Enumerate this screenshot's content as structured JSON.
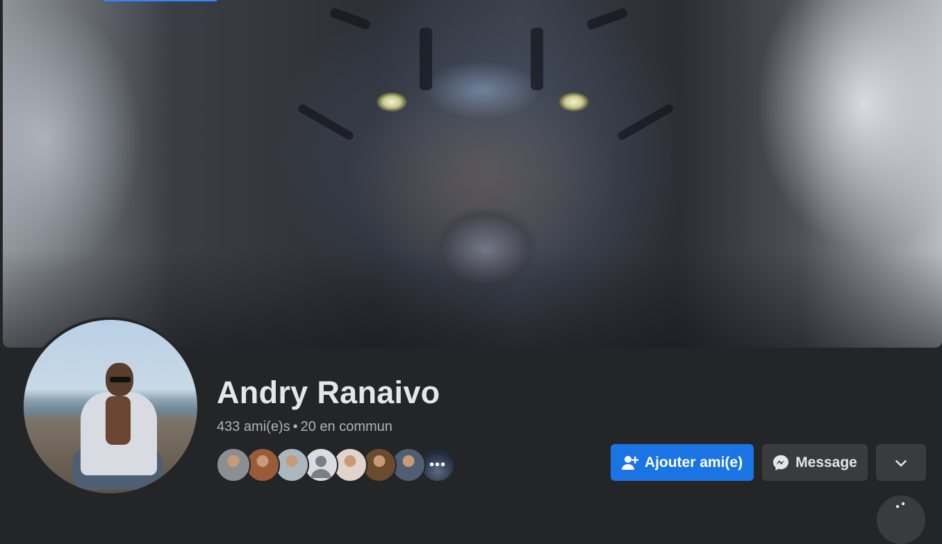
{
  "profile": {
    "name": "Andry Ranaivo",
    "friend_count": "433 ami(e)s",
    "separator": "•",
    "mutual": "20 en commun"
  },
  "mutual_friend_avatars": [
    {
      "bg": "#8b8f94"
    },
    {
      "bg": "#9a5b3a"
    },
    {
      "bg": "#aab7bf"
    },
    {
      "bg": "#c8ccd2",
      "placeholder": true
    },
    {
      "bg": "#e0d4cc"
    },
    {
      "bg": "#6b4a2e"
    },
    {
      "bg": "#4f5e72"
    },
    {
      "bg": "#1f2a3a",
      "more": true
    }
  ],
  "more_avatars_label": "•••",
  "actions": {
    "add_friend": "Ajouter ami(e)",
    "message": "Message"
  },
  "colors": {
    "primary": "#1b74e4",
    "surface": "#242526",
    "button_secondary": "#3a3b3c"
  }
}
